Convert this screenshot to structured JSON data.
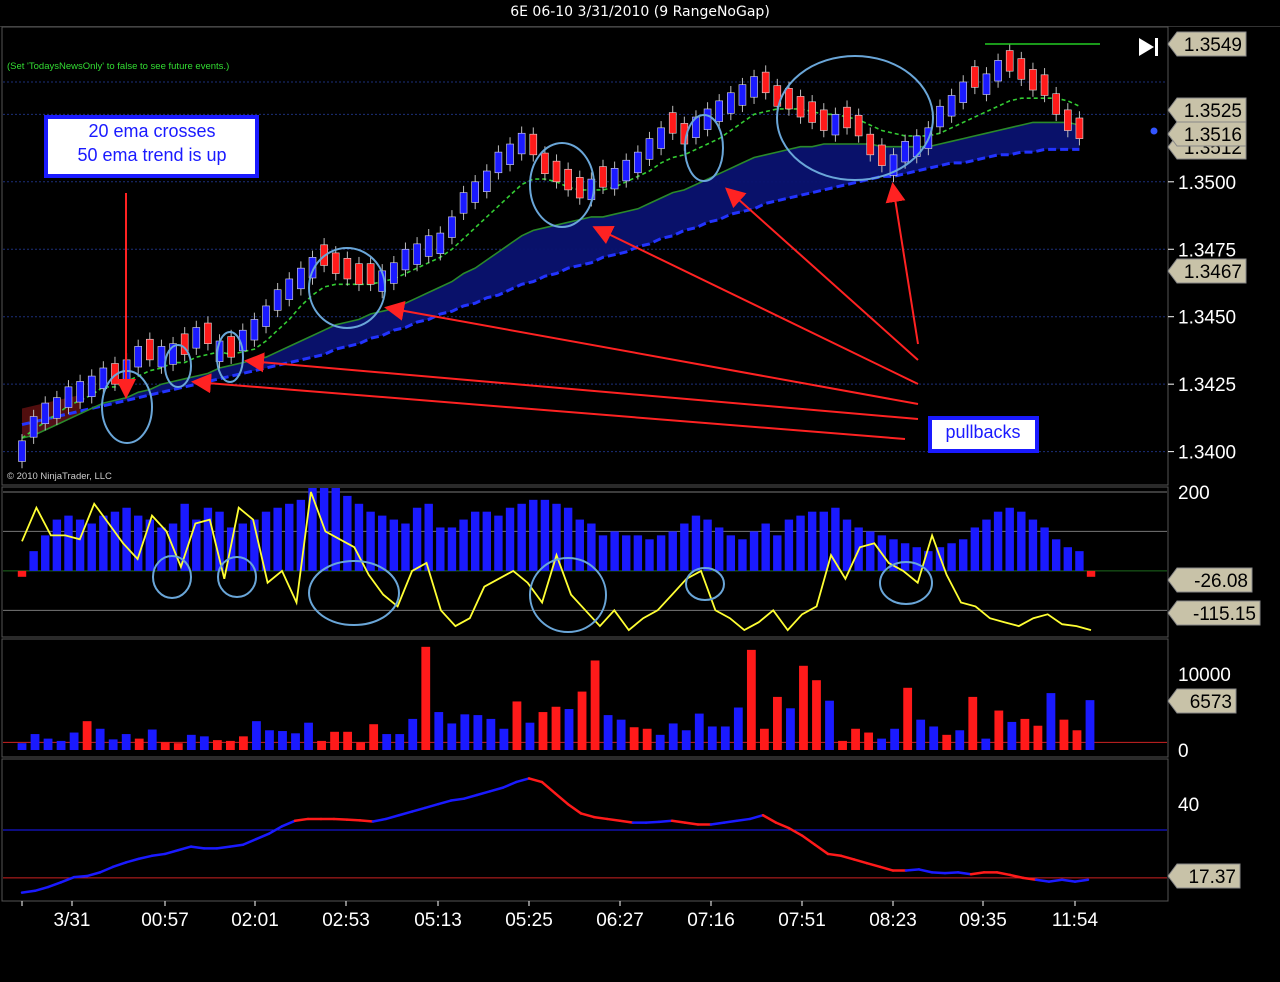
{
  "window": {
    "title": "6E 06-10  3/31/2010 (9 RangeNoGap)"
  },
  "notice": "(Set 'TodaysNewsOnly' to false to see future events.)",
  "copyright": "© 2010 NinjaTrader, LLC",
  "annotations": {
    "ema_note": [
      "20 ema crosses",
      "50 ema trend is up"
    ],
    "pullbacks": "pullbacks"
  },
  "colors": {
    "up_bar": "#1a1aff",
    "down_bar": "#ff1a1a",
    "ema_fast": "#33cc33",
    "ema_slow": "#2a8a2a",
    "ema_long": "#2233ff",
    "cloud": "#0a1270",
    "cci": "#ffff33",
    "arrow": "#ff2222",
    "circle": "#6aa6d8",
    "label_bg": "#c8c2a8"
  },
  "chart_data": [
    {
      "type": "candlestick",
      "name": "price",
      "ylim": [
        1.3388,
        1.3557
      ],
      "yticks": [
        "1.3400",
        "1.3425",
        "1.3450",
        "1.3475",
        "1.3500"
      ],
      "price_labels": [
        "1.3549",
        "1.3525",
        "1.3516",
        "1.3512",
        "1.3467"
      ],
      "close": [
        1.3404,
        1.3413,
        1.3418,
        1.342,
        1.3424,
        1.3426,
        1.3428,
        1.3431,
        1.3425,
        1.3434,
        1.3439,
        1.3434,
        1.3439,
        1.344,
        1.3436,
        1.3446,
        1.344,
        1.3441,
        1.3435,
        1.3445,
        1.3449,
        1.3454,
        1.346,
        1.3464,
        1.3468,
        1.3472,
        1.3469,
        1.3466,
        1.3464,
        1.3462,
        1.3462,
        1.3467,
        1.347,
        1.3475,
        1.3477,
        1.348,
        1.3481,
        1.3487,
        1.3496,
        1.35,
        1.3504,
        1.3511,
        1.3514,
        1.3518,
        1.351,
        1.3503,
        1.35,
        1.3497,
        1.3494,
        1.3501,
        1.3498,
        1.3505,
        1.3508,
        1.3511,
        1.3516,
        1.352,
        1.3518,
        1.3514,
        1.3524,
        1.3527,
        1.353,
        1.3533,
        1.3536,
        1.3539,
        1.3533,
        1.3528,
        1.3527,
        1.3524,
        1.3522,
        1.3519,
        1.3525,
        1.352,
        1.3517,
        1.351,
        1.3506,
        1.351,
        1.3515,
        1.3517,
        1.352,
        1.3528,
        1.3532,
        1.3537,
        1.3535,
        1.354,
        1.3545,
        1.3541,
        1.3538,
        1.3534,
        1.3532,
        1.3525,
        1.3519,
        1.3516
      ],
      "bar_color": [
        1,
        1,
        1,
        1,
        1,
        1,
        1,
        1,
        0,
        1,
        1,
        0,
        1,
        1,
        0,
        1,
        0,
        1,
        0,
        1,
        1,
        1,
        1,
        1,
        1,
        1,
        0,
        0,
        0,
        0,
        0,
        1,
        1,
        1,
        1,
        1,
        1,
        1,
        1,
        1,
        1,
        1,
        1,
        1,
        0,
        0,
        0,
        0,
        0,
        1,
        0,
        1,
        1,
        1,
        1,
        1,
        0,
        0,
        1,
        1,
        1,
        1,
        1,
        1,
        0,
        0,
        0,
        0,
        0,
        0,
        1,
        0,
        0,
        0,
        0,
        1,
        1,
        1,
        1,
        1,
        1,
        1,
        0,
        1,
        1,
        0,
        0,
        0,
        0,
        0,
        0,
        0
      ],
      "ema_fast": [
        1.3405,
        1.3408,
        1.3411,
        1.3414,
        1.3417,
        1.3419,
        1.3421,
        1.3424,
        1.3424,
        1.3426,
        1.3428,
        1.343,
        1.3431,
        1.3433,
        1.3433,
        1.3435,
        1.3436,
        1.3437,
        1.3436,
        1.3437,
        1.3438,
        1.3441,
        1.3445,
        1.3449,
        1.3454,
        1.3458,
        1.3461,
        1.3462,
        1.3462,
        1.3462,
        1.3462,
        1.3463,
        1.3464,
        1.3466,
        1.3468,
        1.347,
        1.3472,
        1.3475,
        1.3479,
        1.3483,
        1.3487,
        1.3491,
        1.3495,
        1.3499,
        1.3501,
        1.3501,
        1.35,
        1.3498,
        1.3497,
        1.3497,
        1.3497,
        1.3498,
        1.35,
        1.3502,
        1.3504,
        1.3507,
        1.3509,
        1.351,
        1.3512,
        1.3514,
        1.3516,
        1.3519,
        1.3522,
        1.3525,
        1.3526,
        1.3527,
        1.3527,
        1.3527,
        1.3526,
        1.3525,
        1.3525,
        1.3524,
        1.3523,
        1.3521,
        1.3519,
        1.3518,
        1.3517,
        1.3517,
        1.3517,
        1.3518,
        1.352,
        1.3522,
        1.3524,
        1.3526,
        1.3528,
        1.353,
        1.3531,
        1.3531,
        1.3531,
        1.3531,
        1.353,
        1.3528
      ],
      "ema_slow": [
        1.3405,
        1.3406,
        1.3408,
        1.341,
        1.3412,
        1.3414,
        1.3416,
        1.3418,
        1.3419,
        1.342,
        1.3422,
        1.3423,
        1.3425,
        1.3426,
        1.3427,
        1.3428,
        1.3429,
        1.3431,
        1.3432,
        1.3433,
        1.3434,
        1.3435,
        1.3437,
        1.3439,
        1.3441,
        1.3443,
        1.3445,
        1.3447,
        1.3448,
        1.3449,
        1.3451,
        1.3452,
        1.3453,
        1.3455,
        1.3457,
        1.3459,
        1.3461,
        1.3463,
        1.3466,
        1.3468,
        1.3471,
        1.3474,
        1.3477,
        1.348,
        1.3482,
        1.3483,
        1.3484,
        1.3485,
        1.3486,
        1.3487,
        1.3487,
        1.3488,
        1.3489,
        1.349,
        1.3492,
        1.3494,
        1.3496,
        1.3497,
        1.3499,
        1.3501,
        1.3503,
        1.3505,
        1.3507,
        1.3509,
        1.351,
        1.3511,
        1.3512,
        1.3513,
        1.3513,
        1.3514,
        1.3514,
        1.3514,
        1.3514,
        1.3514,
        1.3513,
        1.3513,
        1.3513,
        1.3513,
        1.3513,
        1.3514,
        1.3515,
        1.3516,
        1.3517,
        1.3518,
        1.3519,
        1.352,
        1.3521,
        1.3522,
        1.3522,
        1.3522,
        1.3522,
        1.3521
      ],
      "ema_long": [
        1.341,
        1.3411,
        1.3412,
        1.3413,
        1.3414,
        1.3415,
        1.3416,
        1.3417,
        1.3418,
        1.3419,
        1.342,
        1.3421,
        1.3422,
        1.3423,
        1.3424,
        1.3425,
        1.3426,
        1.3427,
        1.3428,
        1.3429,
        1.343,
        1.3431,
        1.3432,
        1.3433,
        1.3434,
        1.3435,
        1.3436,
        1.3438,
        1.3439,
        1.344,
        1.3442,
        1.3443,
        1.3445,
        1.3446,
        1.3448,
        1.3449,
        1.3451,
        1.3452,
        1.3454,
        1.3455,
        1.3457,
        1.3458,
        1.346,
        1.3462,
        1.3463,
        1.3465,
        1.3466,
        1.3468,
        1.3469,
        1.347,
        1.3472,
        1.3473,
        1.3474,
        1.3476,
        1.3477,
        1.3479,
        1.348,
        1.3482,
        1.3483,
        1.3485,
        1.3486,
        1.3488,
        1.3489,
        1.349,
        1.3492,
        1.3493,
        1.3494,
        1.3495,
        1.3496,
        1.3497,
        1.3498,
        1.3499,
        1.35,
        1.3501,
        1.3502,
        1.3502,
        1.3503,
        1.3504,
        1.3505,
        1.3506,
        1.3507,
        1.3507,
        1.3508,
        1.3509,
        1.351,
        1.351,
        1.3511,
        1.3511,
        1.3512,
        1.3512,
        1.3512,
        1.3512
      ]
    },
    {
      "type": "bar+line",
      "name": "cci",
      "ylim": [
        -165,
        210
      ],
      "yticks": [
        "200"
      ],
      "levels": [
        200,
        100,
        0,
        -100
      ],
      "value_labels": [
        "-26.08",
        "-115.15"
      ],
      "histogram": [
        -15,
        50,
        90,
        130,
        140,
        130,
        120,
        140,
        150,
        160,
        140,
        130,
        110,
        120,
        170,
        130,
        160,
        150,
        110,
        120,
        130,
        150,
        160,
        170,
        180,
        210,
        210,
        210,
        190,
        170,
        150,
        140,
        130,
        120,
        160,
        170,
        110,
        110,
        130,
        150,
        150,
        140,
        160,
        170,
        180,
        180,
        170,
        160,
        130,
        120,
        90,
        100,
        90,
        90,
        80,
        90,
        100,
        120,
        140,
        130,
        110,
        90,
        80,
        100,
        120,
        90,
        130,
        140,
        150,
        150,
        160,
        130,
        110,
        100,
        90,
        80,
        70,
        60,
        50,
        60,
        70,
        80,
        110,
        130,
        150,
        160,
        150,
        130,
        110,
        80,
        60,
        50,
        -15
      ],
      "line": [
        75,
        160,
        90,
        90,
        80,
        170,
        120,
        70,
        30,
        140,
        100,
        10,
        120,
        130,
        -20,
        160,
        130,
        -30,
        0,
        -80,
        200,
        100,
        80,
        60,
        -10,
        -60,
        -90,
        0,
        20,
        -100,
        -140,
        -120,
        -40,
        -20,
        0,
        -30,
        -80,
        40,
        -60,
        -100,
        -140,
        -100,
        -150,
        -120,
        -100,
        -60,
        -20,
        0,
        -100,
        -120,
        -150,
        -130,
        -100,
        -150,
        -110,
        -90,
        40,
        -20,
        60,
        70,
        20,
        0,
        -30,
        90,
        -10,
        -80,
        -90,
        -120,
        -130,
        -140,
        -120,
        -110,
        -135,
        -140,
        -150
      ]
    },
    {
      "type": "bar",
      "name": "volume",
      "ylim": [
        0,
        14500
      ],
      "yticks": [
        "10000",
        "0"
      ],
      "value_labels": [
        "6573"
      ],
      "values": [
        900,
        2100,
        1500,
        1200,
        2300,
        3800,
        2800,
        1400,
        2100,
        1500,
        2700,
        1000,
        900,
        2000,
        1800,
        1300,
        1200,
        1800,
        3800,
        2600,
        2500,
        2200,
        3600,
        1200,
        2400,
        2400,
        1000,
        3400,
        2100,
        2100,
        4100,
        13600,
        5000,
        3500,
        4700,
        4600,
        4100,
        2800,
        6400,
        3600,
        5000,
        5700,
        5400,
        7700,
        11800,
        4600,
        4000,
        3000,
        2800,
        2000,
        3500,
        2600,
        4800,
        3100,
        3100,
        5600,
        13200,
        2800,
        7000,
        5500,
        11100,
        9200,
        6500,
        1200,
        2800,
        2300,
        1500,
        2800,
        8200,
        4000,
        3100,
        2000,
        2600,
        7000,
        1500,
        5200,
        3700,
        4100,
        3200,
        7500,
        4000,
        2600,
        6573
      ],
      "bar_color": [
        1,
        1,
        1,
        1,
        1,
        0,
        1,
        1,
        1,
        0,
        1,
        0,
        0,
        1,
        1,
        0,
        0,
        0,
        1,
        1,
        1,
        1,
        1,
        0,
        0,
        0,
        0,
        0,
        1,
        1,
        1,
        0,
        1,
        1,
        1,
        1,
        1,
        1,
        0,
        1,
        0,
        0,
        1,
        0,
        0,
        1,
        1,
        0,
        0,
        1,
        1,
        1,
        1,
        1,
        1,
        1,
        0,
        0,
        0,
        1,
        0,
        0,
        1,
        0,
        0,
        0,
        1,
        1,
        0,
        1,
        1,
        0,
        1,
        0,
        1,
        0,
        1,
        0,
        0,
        1,
        0,
        0,
        1
      ]
    },
    {
      "type": "line",
      "name": "adx",
      "ylim": [
        14,
        52
      ],
      "yticks": [
        "40"
      ],
      "levels": [
        33,
        20
      ],
      "value_labels": [
        "17.37"
      ],
      "values": [
        16.0,
        16.5,
        17.5,
        18.8,
        20.2,
        20.5,
        21.5,
        23.0,
        24.2,
        25.2,
        26.0,
        26.5,
        27.5,
        28.5,
        28.0,
        28.0,
        28.5,
        29.0,
        30.5,
        32.0,
        34.0,
        35.5,
        36.0,
        36.0,
        36.0,
        35.8,
        35.6,
        35.3,
        36.0,
        37.0,
        38.0,
        39.0,
        40.0,
        41.0,
        41.5,
        42.5,
        43.5,
        44.5,
        46.0,
        47.0,
        46.0,
        43.0,
        40.0,
        37.5,
        36.5,
        36.0,
        35.5,
        35.0,
        35.0,
        35.2,
        35.5,
        35.0,
        34.5,
        34.5,
        35.0,
        35.5,
        36.0,
        37.0,
        35.0,
        33.5,
        31.5,
        29.0,
        26.5,
        26.0,
        25.0,
        24.0,
        23.0,
        22.0,
        22.0,
        22.3,
        21.5,
        21.3,
        21.5,
        21.0,
        21.5,
        21.5,
        20.8,
        20.0,
        19.5,
        19.0,
        19.5,
        19.0,
        19.5
      ],
      "segment_color": [
        1,
        1,
        1,
        1,
        1,
        1,
        1,
        1,
        1,
        1,
        1,
        1,
        1,
        1,
        1,
        1,
        1,
        1,
        1,
        1,
        1,
        1,
        0,
        0,
        0,
        0,
        0,
        0,
        1,
        1,
        1,
        1,
        1,
        1,
        1,
        1,
        1,
        1,
        1,
        1,
        0,
        0,
        0,
        0,
        0,
        0,
        0,
        0,
        1,
        1,
        1,
        0,
        0,
        0,
        1,
        1,
        1,
        1,
        0,
        0,
        0,
        0,
        0,
        0,
        0,
        0,
        0,
        0,
        0,
        1,
        1,
        1,
        1,
        1,
        0,
        0,
        0,
        0,
        0,
        1,
        1,
        1,
        1
      ]
    }
  ],
  "x_axis": {
    "ticks": [
      "3/31",
      "00:57",
      "02:01",
      "02:53",
      "05:13",
      "05:25",
      "06:27",
      "07:16",
      "07:51",
      "08:23",
      "09:35",
      "11:54"
    ]
  }
}
